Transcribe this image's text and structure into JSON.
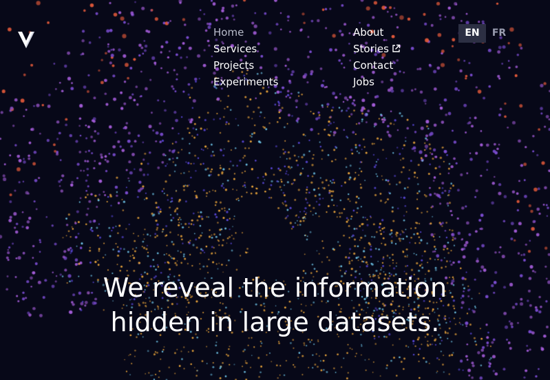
{
  "logo": {
    "name": "V",
    "color": "#ffffff"
  },
  "nav": {
    "left": [
      {
        "label": "Home",
        "current": true
      },
      {
        "label": "Services"
      },
      {
        "label": "Projects"
      },
      {
        "label": "Experiments"
      }
    ],
    "right": [
      {
        "label": "About"
      },
      {
        "label": "Stories",
        "external": true,
        "icon": "external-link-icon"
      },
      {
        "label": "Contact"
      },
      {
        "label": "Jobs"
      }
    ]
  },
  "language": {
    "options": [
      "EN",
      "FR"
    ],
    "selected": "EN"
  },
  "hero": {
    "line1": "We reveal the information",
    "line2": "hidden in large datasets."
  },
  "colors": {
    "background": "#070818",
    "dot_palette": [
      "#a25bd6",
      "#7a4ccf",
      "#f0a93c",
      "#6ec3e6",
      "#e2593a",
      "#5a48d8"
    ]
  }
}
